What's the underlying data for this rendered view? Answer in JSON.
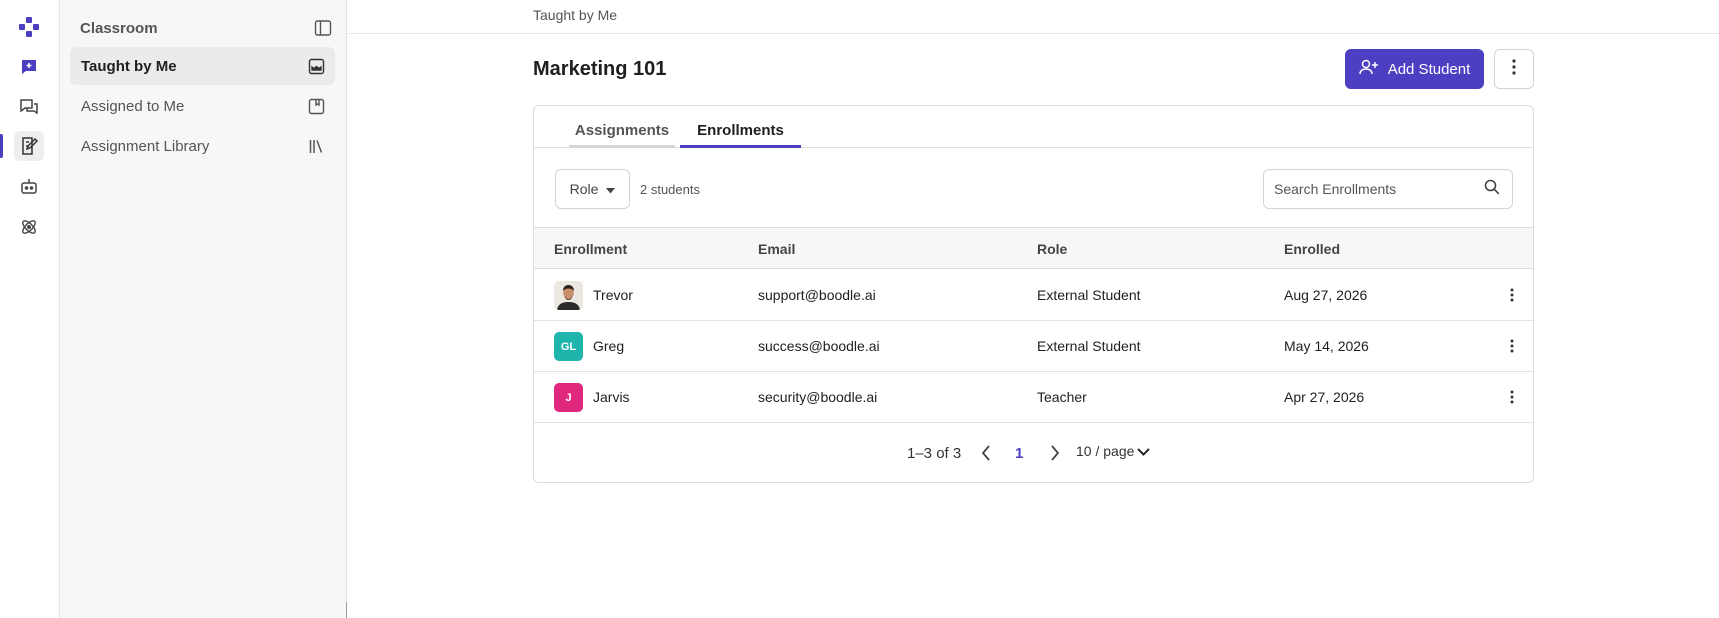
{
  "colors": {
    "accent": "#4d3fc1",
    "avatar_greg": "#1fb5ad",
    "avatar_jarvis": "#e0277e"
  },
  "rail": {
    "icons": [
      "logo-icon",
      "new-chat-icon",
      "chats-icon",
      "classroom-icon",
      "bot-icon",
      "atom-icon"
    ]
  },
  "sidebar": {
    "title": "Classroom",
    "items": [
      {
        "label": "Taught by Me",
        "icon": "inbox-icon",
        "active": true
      },
      {
        "label": "Assigned to Me",
        "icon": "bookmark-icon",
        "active": false
      },
      {
        "label": "Assignment Library",
        "icon": "library-icon",
        "active": false
      }
    ]
  },
  "breadcrumb": "Taught by Me",
  "page": {
    "title": "Marketing 101",
    "add_button": "Add Student"
  },
  "tabs": [
    {
      "label": "Assignments",
      "active": false
    },
    {
      "label": "Enrollments",
      "active": true
    }
  ],
  "filters": {
    "role_label": "Role",
    "count": "2 students",
    "search_placeholder": "Search Enrollments"
  },
  "table": {
    "columns": [
      "Enrollment",
      "Email",
      "Role",
      "Enrolled"
    ],
    "rows": [
      {
        "name": "Trevor",
        "initials": "",
        "email": "support@boodle.ai",
        "role": "External Student",
        "enrolled": "Aug 27, 2026"
      },
      {
        "name": "Greg",
        "initials": "GL",
        "email": "success@boodle.ai",
        "role": "External Student",
        "enrolled": "May 14, 2026"
      },
      {
        "name": "Jarvis",
        "initials": "J",
        "email": "security@boodle.ai",
        "role": "Teacher",
        "enrolled": "Apr 27, 2026"
      }
    ]
  },
  "pagination": {
    "range": "1–3 of 3",
    "current_page": "1",
    "page_size": "10 / page"
  }
}
